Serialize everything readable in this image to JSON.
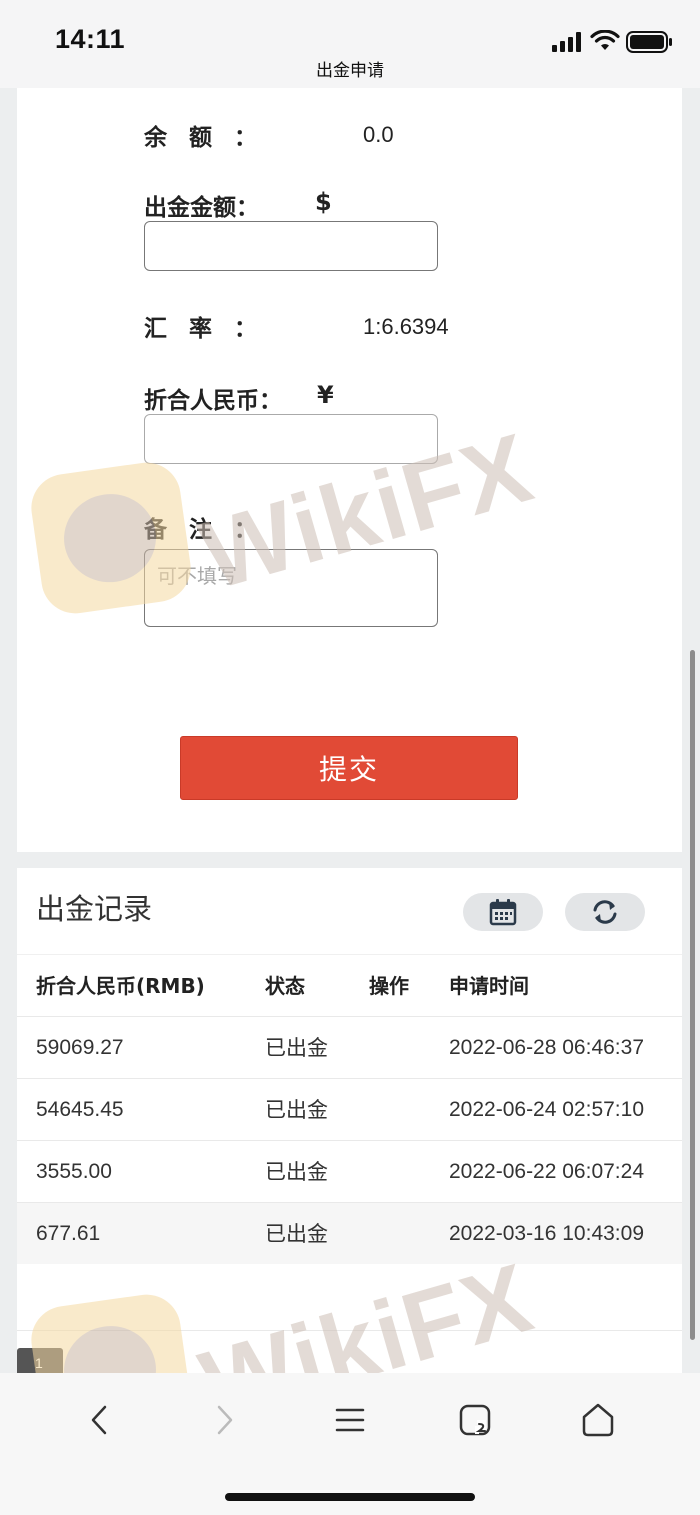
{
  "status_bar": {
    "time": "14:11"
  },
  "header": {
    "title": "出金申请"
  },
  "form": {
    "balance_label": "余额：",
    "balance_value": "0.0",
    "amount_label": "出金金额：",
    "amount_currency": "$",
    "amount_value": "",
    "rate_label": "汇率：",
    "rate_value": "1:6.6394",
    "rmb_label": "折合人民币：",
    "rmb_currency": "¥",
    "rmb_value": "",
    "note_label": "备注：",
    "note_placeholder": "可不填写",
    "submit_label": "提交"
  },
  "records": {
    "title": "出金记录",
    "columns": [
      "折合人民币(RMB)",
      "状态",
      "操作",
      "申请时间"
    ],
    "rows": [
      {
        "amount": "59069.27",
        "status": "已出金",
        "action": "",
        "time": "2022-06-28 06:46:37"
      },
      {
        "amount": "54645.45",
        "status": "已出金",
        "action": "",
        "time": "2022-06-24 02:57:10"
      },
      {
        "amount": "3555.00",
        "status": "已出金",
        "action": "",
        "time": "2022-06-22 06:07:24"
      },
      {
        "amount": "677.61",
        "status": "已出金",
        "action": "",
        "time": "2022-03-16 10:43:09"
      }
    ],
    "page_number": "1"
  },
  "watermark": {
    "text": "WikiFX",
    "color": "#cdbfb5",
    "logo_color": "#f5d9a2"
  },
  "icons": {
    "calendar": "calendar-icon",
    "refresh": "refresh-icon",
    "back": "chevron-left-icon",
    "forward": "chevron-right-icon",
    "menu": "menu-icon",
    "tabs": "tabs-icon",
    "home": "home-icon"
  },
  "colors": {
    "submit": "#e14a36",
    "background": "#eceeef"
  }
}
